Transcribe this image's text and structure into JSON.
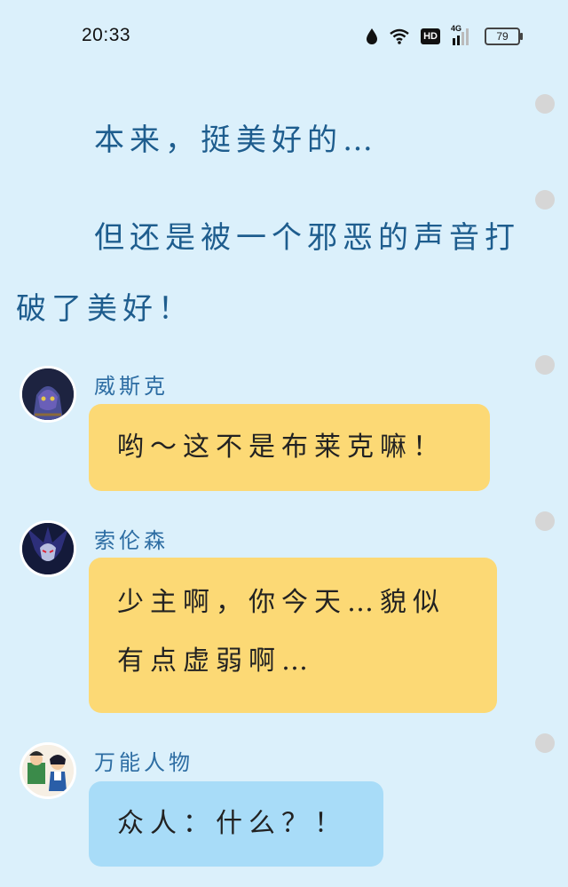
{
  "status_bar": {
    "time": "20:33",
    "hd_label": "HD",
    "network_label": "4G",
    "battery": "79"
  },
  "narration": {
    "line1": "本来，挺美好的…",
    "line2a": "但还是被一个邪恶的声音打",
    "line2b": "破了美好！"
  },
  "messages": [
    {
      "sender": "威斯克",
      "text": "哟～这不是布莱克嘛！",
      "bubble_color": "#fcd975"
    },
    {
      "sender": "索伦森",
      "text_line1": "少主啊，你今天…貌似",
      "text_line2": "有点虚弱啊…",
      "bubble_color": "#fcd975"
    },
    {
      "sender": "万能人物",
      "text": "众人：什么？！",
      "bubble_color": "#a8dcf8"
    }
  ]
}
